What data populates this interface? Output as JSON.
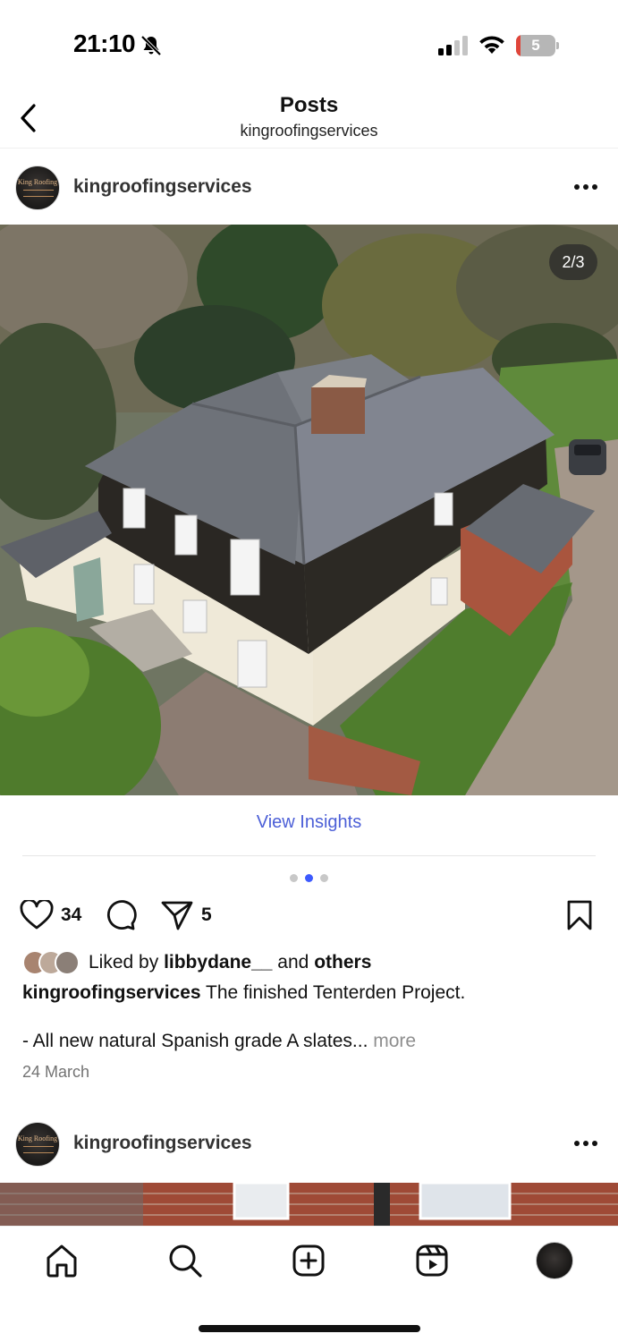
{
  "status_bar": {
    "time": "21:10",
    "battery_level": "5",
    "battery_percent": 5,
    "battery_color": "#e0453a",
    "icons": [
      "bell-slash-icon",
      "signal-icon",
      "wifi-icon",
      "battery-icon"
    ]
  },
  "header": {
    "back_icon": "chevron-left-icon",
    "title": "Posts",
    "subtitle": "kingroofingservices"
  },
  "post": {
    "avatar_text": "King Roofing",
    "username": "kingroofingservices",
    "more_icon": "ellipsis-icon",
    "image_counter": "2/3",
    "carousel": {
      "count": 3,
      "active_index": 1
    },
    "view_insights": "View Insights",
    "likes": "34",
    "shares": "5",
    "liked_by_prefix": "Liked by",
    "liked_by_user": "libbydane__",
    "liked_by_and": "and",
    "liked_by_others": "others",
    "caption_user": "kingroofingservices",
    "caption_text": "The finished Tenterden Project.",
    "caption_detail": "- All new natural Spanish grade A slates...",
    "more_label": "more",
    "date": "24 March",
    "accent_color": "#4c5fd7"
  },
  "next_post": {
    "avatar_text": "King Roofing",
    "username": "kingroofingservices"
  },
  "bottom_nav": {
    "items": [
      "home-icon",
      "search-icon",
      "new-post-icon",
      "reels-icon",
      "profile-avatar"
    ]
  }
}
